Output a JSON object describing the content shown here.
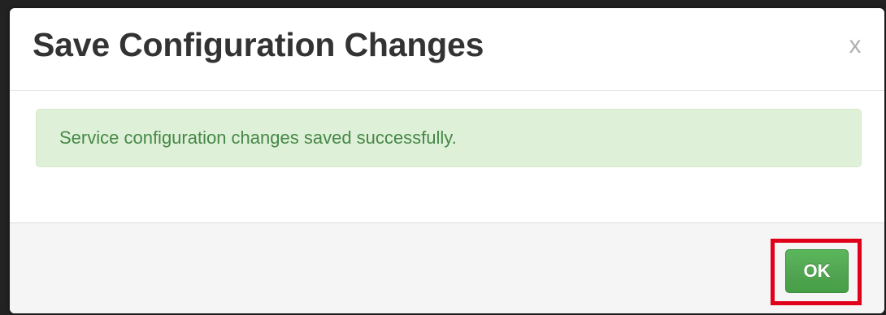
{
  "dialog": {
    "title": "Save Configuration Changes",
    "close_label": "x",
    "message": "Service configuration changes saved successfully.",
    "ok_label": "OK"
  },
  "colors": {
    "success_bg": "#dff0d8",
    "success_text": "#468847",
    "ok_button": "#51a351",
    "highlight": "#e0001a"
  }
}
